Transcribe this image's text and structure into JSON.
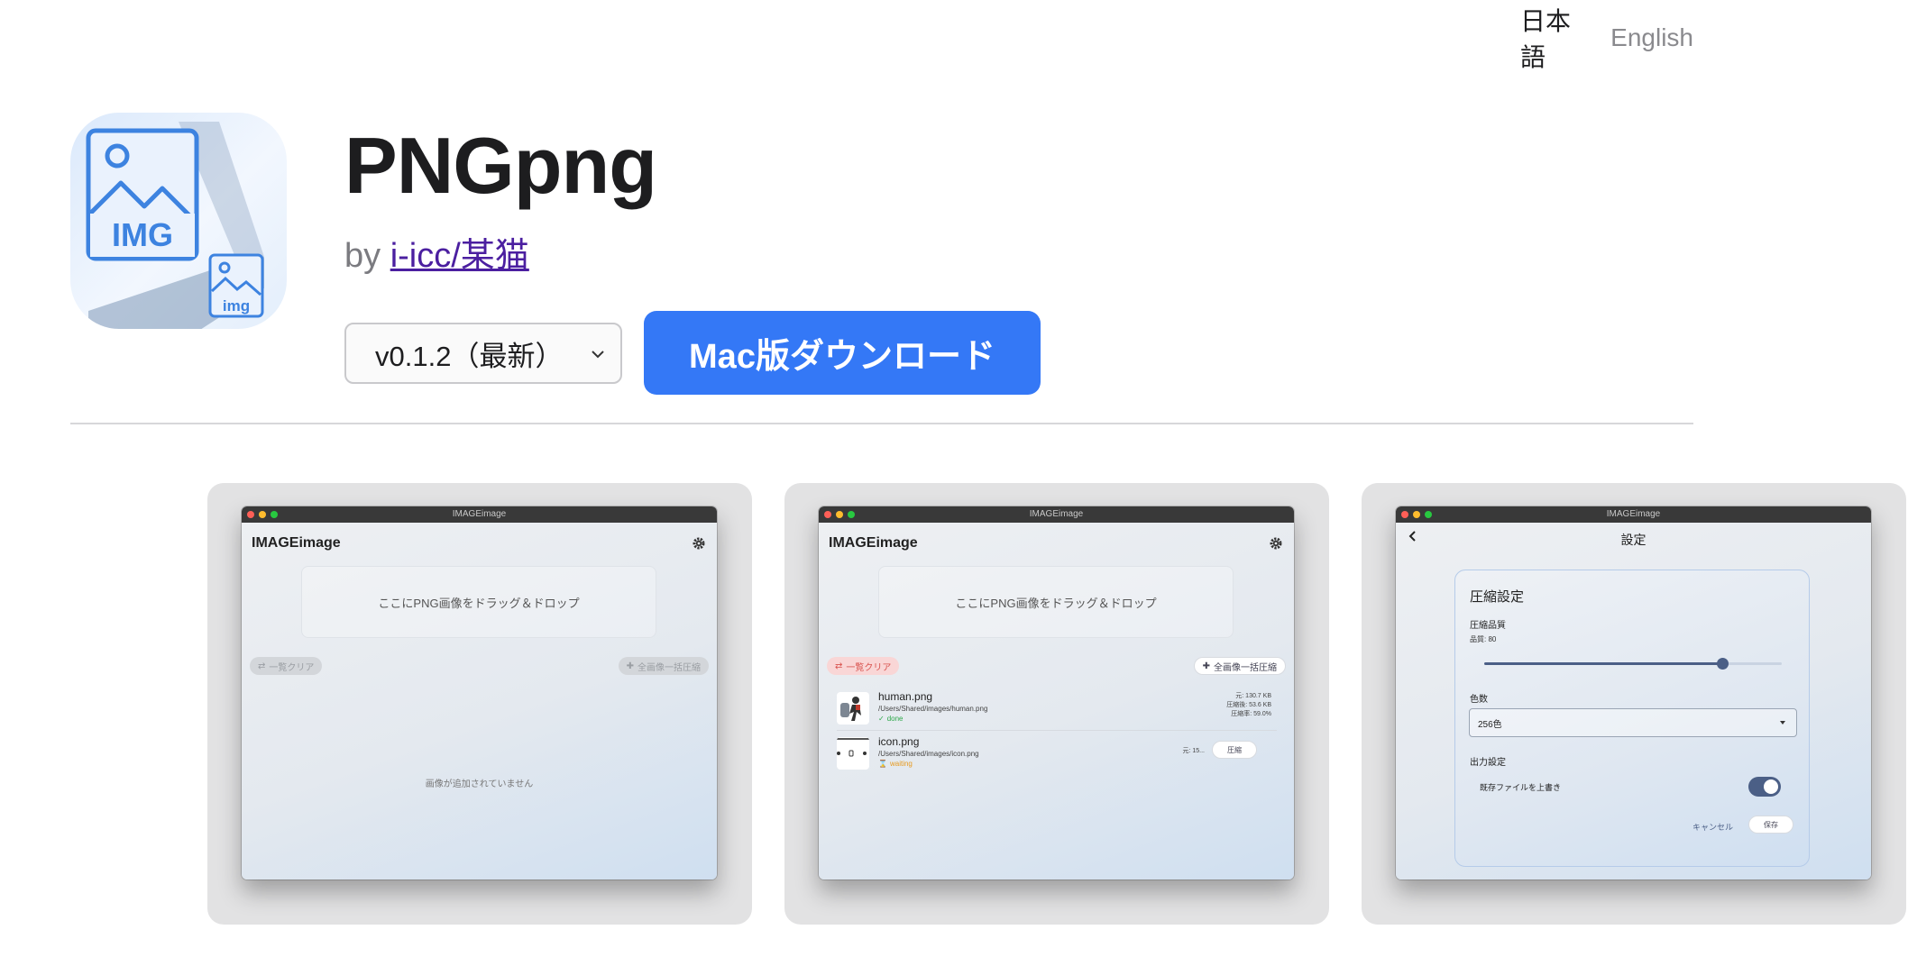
{
  "lang_switch": {
    "ja": "日本語",
    "en": "English"
  },
  "app": {
    "name": "PNGpng",
    "by_prefix": "by",
    "author": "i-icc/某猫",
    "icon_text_large": "IMG",
    "icon_text_small": "img"
  },
  "version_select": {
    "selected": "v0.1.2（最新）"
  },
  "download_button": "Mac版ダウンロード",
  "colors": {
    "accent": "#3478f6",
    "link": "#4b1fa0"
  },
  "screenshots": [
    {
      "window_title": "IMAGEimage",
      "app_title": "IMAGEimage",
      "dropzone": "ここにPNG画像をドラッグ＆ドロップ",
      "clear_button": "一覧クリア",
      "compress_all_button": "全画像一括圧縮",
      "empty_message": "画像が追加されていません"
    },
    {
      "window_title": "IMAGEimage",
      "app_title": "IMAGEimage",
      "dropzone": "ここにPNG画像をドラッグ＆ドロップ",
      "clear_button": "一覧クリア",
      "compress_all_button": "全画像一括圧縮",
      "files": [
        {
          "name": "human.png",
          "path": "/Users/Shared/images/human.png",
          "status": "done",
          "stat1": "元: 130.7 KB",
          "stat2": "圧縮後: 53.6 KB",
          "stat3": "圧縮率: 59.0%"
        },
        {
          "name": "icon.png",
          "path": "/Users/Shared/images/icon.png",
          "status": "waiting",
          "stat1": "元: 15...",
          "compress_button": "圧縮"
        }
      ]
    },
    {
      "window_title": "IMAGEimage",
      "settings_title": "設定",
      "section_compression": "圧縮設定",
      "quality_label": "圧縮品質",
      "quality_value": "品質: 80",
      "quality": 80,
      "colors_label": "色数",
      "colors_value": "256色",
      "section_output": "出力設定",
      "overwrite_label": "既存ファイルを上書き",
      "overwrite_enabled": true,
      "cancel_button": "キャンセル",
      "save_button": "保存"
    }
  ]
}
